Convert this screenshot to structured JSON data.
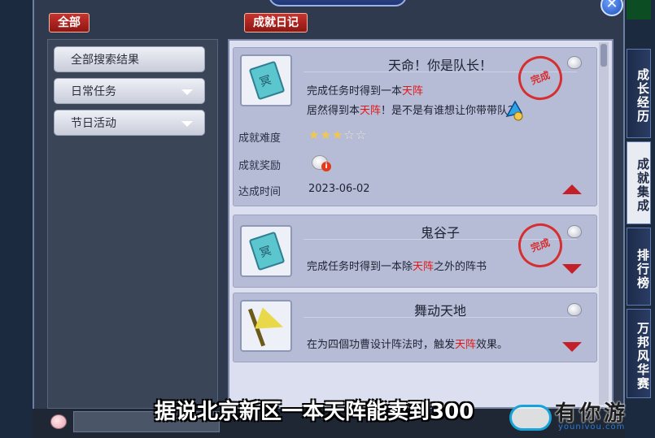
{
  "header": {
    "tab_all": "全部",
    "tab_diary": "成就日记",
    "close_symbol": "✕"
  },
  "categories": [
    {
      "label": "全部搜索结果"
    },
    {
      "label": "日常任务"
    },
    {
      "label": "节日活动"
    }
  ],
  "achievements": [
    {
      "title": "天命！你是队长！",
      "line1_pre": "完成任务时得到一本",
      "line1_hl": "天阵",
      "line1_post": "",
      "line2_pre": "居然得到本",
      "line2_hl": "天阵",
      "line2_post": "！是不是有谁想让你带带队？",
      "stamp": "完成",
      "difficulty_label": "成就难度",
      "difficulty_stars": 3,
      "difficulty_max": 5,
      "reward_label": "成就奖励",
      "date_label": "达成时间",
      "date": "2023-06-02",
      "icon": "book-icon",
      "expanded": true
    },
    {
      "title": "鬼谷子",
      "line1_pre": "完成任务时得到一本除",
      "line1_hl": "天阵",
      "line1_post": "之外的阵书",
      "stamp": "完成",
      "icon": "book-icon",
      "expanded": false
    },
    {
      "title": "舞动天地",
      "line1_pre": "在为四個功曹设计阵法时，触发",
      "line1_hl": "天阵",
      "line1_post": "效果。",
      "icon": "flag-icon",
      "expanded": false
    }
  ],
  "side_tabs": [
    {
      "label": "成长经历"
    },
    {
      "label": "成就集成"
    },
    {
      "label": "排行榜"
    },
    {
      "label": "万邦风华赛"
    }
  ],
  "overlay": {
    "subtitle": "据说北京新区一本天阵能卖到300",
    "logo_text": "有你游",
    "logo_url": "younivou.com"
  },
  "colors": {
    "accent_red": "#c3202a",
    "highlight_text": "#e01818",
    "star": "#f2c84a"
  }
}
